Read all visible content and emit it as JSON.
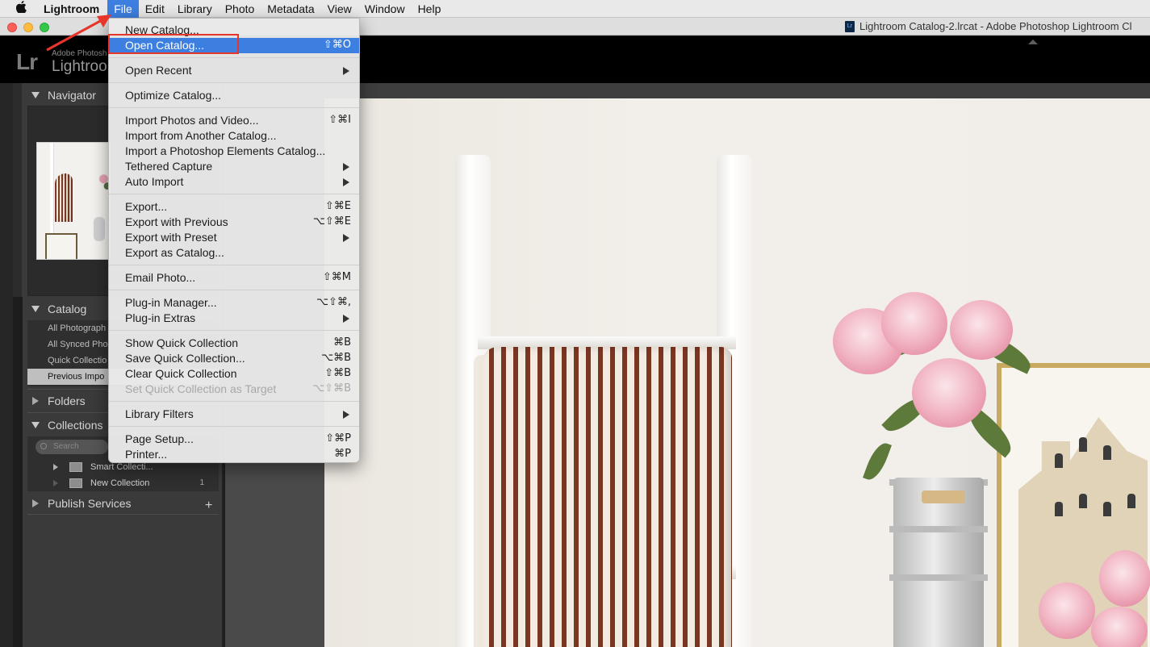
{
  "menubar": {
    "apple_icon": "apple-icon",
    "app_name": "Lightroom",
    "items": [
      "File",
      "Edit",
      "Library",
      "Photo",
      "Metadata",
      "View",
      "Window",
      "Help"
    ],
    "active_item": "File"
  },
  "window": {
    "title": "Lightroom Catalog-2.lrcat - Adobe Photoshop Lightroom Cl",
    "doc_icon_text": "Lr"
  },
  "brand": {
    "logo": "Lr",
    "small": "Adobe Photosh",
    "big": "Lightroo"
  },
  "file_menu": {
    "items": [
      {
        "label": "New Catalog...",
        "shortcut": "",
        "submenu": false,
        "highlighted": false,
        "disabled": false
      },
      {
        "label": "Open Catalog...",
        "shortcut": "⇧⌘O",
        "submenu": false,
        "highlighted": true,
        "disabled": false
      },
      {
        "label": "Open Recent",
        "shortcut": "",
        "submenu": true,
        "highlighted": false,
        "disabled": false
      },
      {
        "label": "Optimize Catalog...",
        "shortcut": "",
        "submenu": false,
        "highlighted": false,
        "disabled": false
      },
      {
        "label": "Import Photos and Video...",
        "shortcut": "⇧⌘I",
        "submenu": false,
        "highlighted": false,
        "disabled": false
      },
      {
        "label": "Import from Another Catalog...",
        "shortcut": "",
        "submenu": false,
        "highlighted": false,
        "disabled": false
      },
      {
        "label": "Import a Photoshop Elements Catalog...",
        "shortcut": "",
        "submenu": false,
        "highlighted": false,
        "disabled": false
      },
      {
        "label": "Tethered Capture",
        "shortcut": "",
        "submenu": true,
        "highlighted": false,
        "disabled": false
      },
      {
        "label": "Auto Import",
        "shortcut": "",
        "submenu": true,
        "highlighted": false,
        "disabled": false
      },
      {
        "label": "Export...",
        "shortcut": "⇧⌘E",
        "submenu": false,
        "highlighted": false,
        "disabled": false
      },
      {
        "label": "Export with Previous",
        "shortcut": "⌥⇧⌘E",
        "submenu": false,
        "highlighted": false,
        "disabled": false
      },
      {
        "label": "Export with Preset",
        "shortcut": "",
        "submenu": true,
        "highlighted": false,
        "disabled": false
      },
      {
        "label": "Export as Catalog...",
        "shortcut": "",
        "submenu": false,
        "highlighted": false,
        "disabled": false
      },
      {
        "label": "Email Photo...",
        "shortcut": "⇧⌘M",
        "submenu": false,
        "highlighted": false,
        "disabled": false
      },
      {
        "label": "Plug-in Manager...",
        "shortcut": "⌥⇧⌘,",
        "submenu": false,
        "highlighted": false,
        "disabled": false
      },
      {
        "label": "Plug-in Extras",
        "shortcut": "",
        "submenu": true,
        "highlighted": false,
        "disabled": false
      },
      {
        "label": "Show Quick Collection",
        "shortcut": "⌘B",
        "submenu": false,
        "highlighted": false,
        "disabled": false
      },
      {
        "label": "Save Quick Collection...",
        "shortcut": "⌥⌘B",
        "submenu": false,
        "highlighted": false,
        "disabled": false
      },
      {
        "label": "Clear Quick Collection",
        "shortcut": "⇧⌘B",
        "submenu": false,
        "highlighted": false,
        "disabled": false
      },
      {
        "label": "Set Quick Collection as Target",
        "shortcut": "⌥⇧⌘B",
        "submenu": false,
        "highlighted": false,
        "disabled": true
      },
      {
        "label": "Library Filters",
        "shortcut": "",
        "submenu": true,
        "highlighted": false,
        "disabled": false
      },
      {
        "label": "Page Setup...",
        "shortcut": "⇧⌘P",
        "submenu": false,
        "highlighted": false,
        "disabled": false
      },
      {
        "label": "Printer...",
        "shortcut": "⌘P",
        "submenu": false,
        "highlighted": false,
        "disabled": false
      }
    ]
  },
  "left_panel": {
    "navigator_title": "Navigator",
    "catalog_title": "Catalog",
    "catalog_items": [
      "All Photograph",
      "All Synced Pho",
      "Quick Collectio",
      "Previous Impo"
    ],
    "catalog_selected_index": 3,
    "folders_title": "Folders",
    "collections_title": "Collections",
    "collections_search_placeholder": "Search",
    "collections": [
      {
        "label": "Smart Collecti...",
        "count": ""
      },
      {
        "label": "New Collection",
        "count": "1"
      }
    ],
    "publish_title": "Publish Services",
    "publish_add_icon": "plus-icon"
  },
  "annotations": {
    "arrow_color": "#e8352a",
    "highlight_box_color": "#e8352a"
  },
  "colors": {
    "menu_highlight": "#3d7fe0",
    "panel_bg": "#3a3a3a"
  }
}
